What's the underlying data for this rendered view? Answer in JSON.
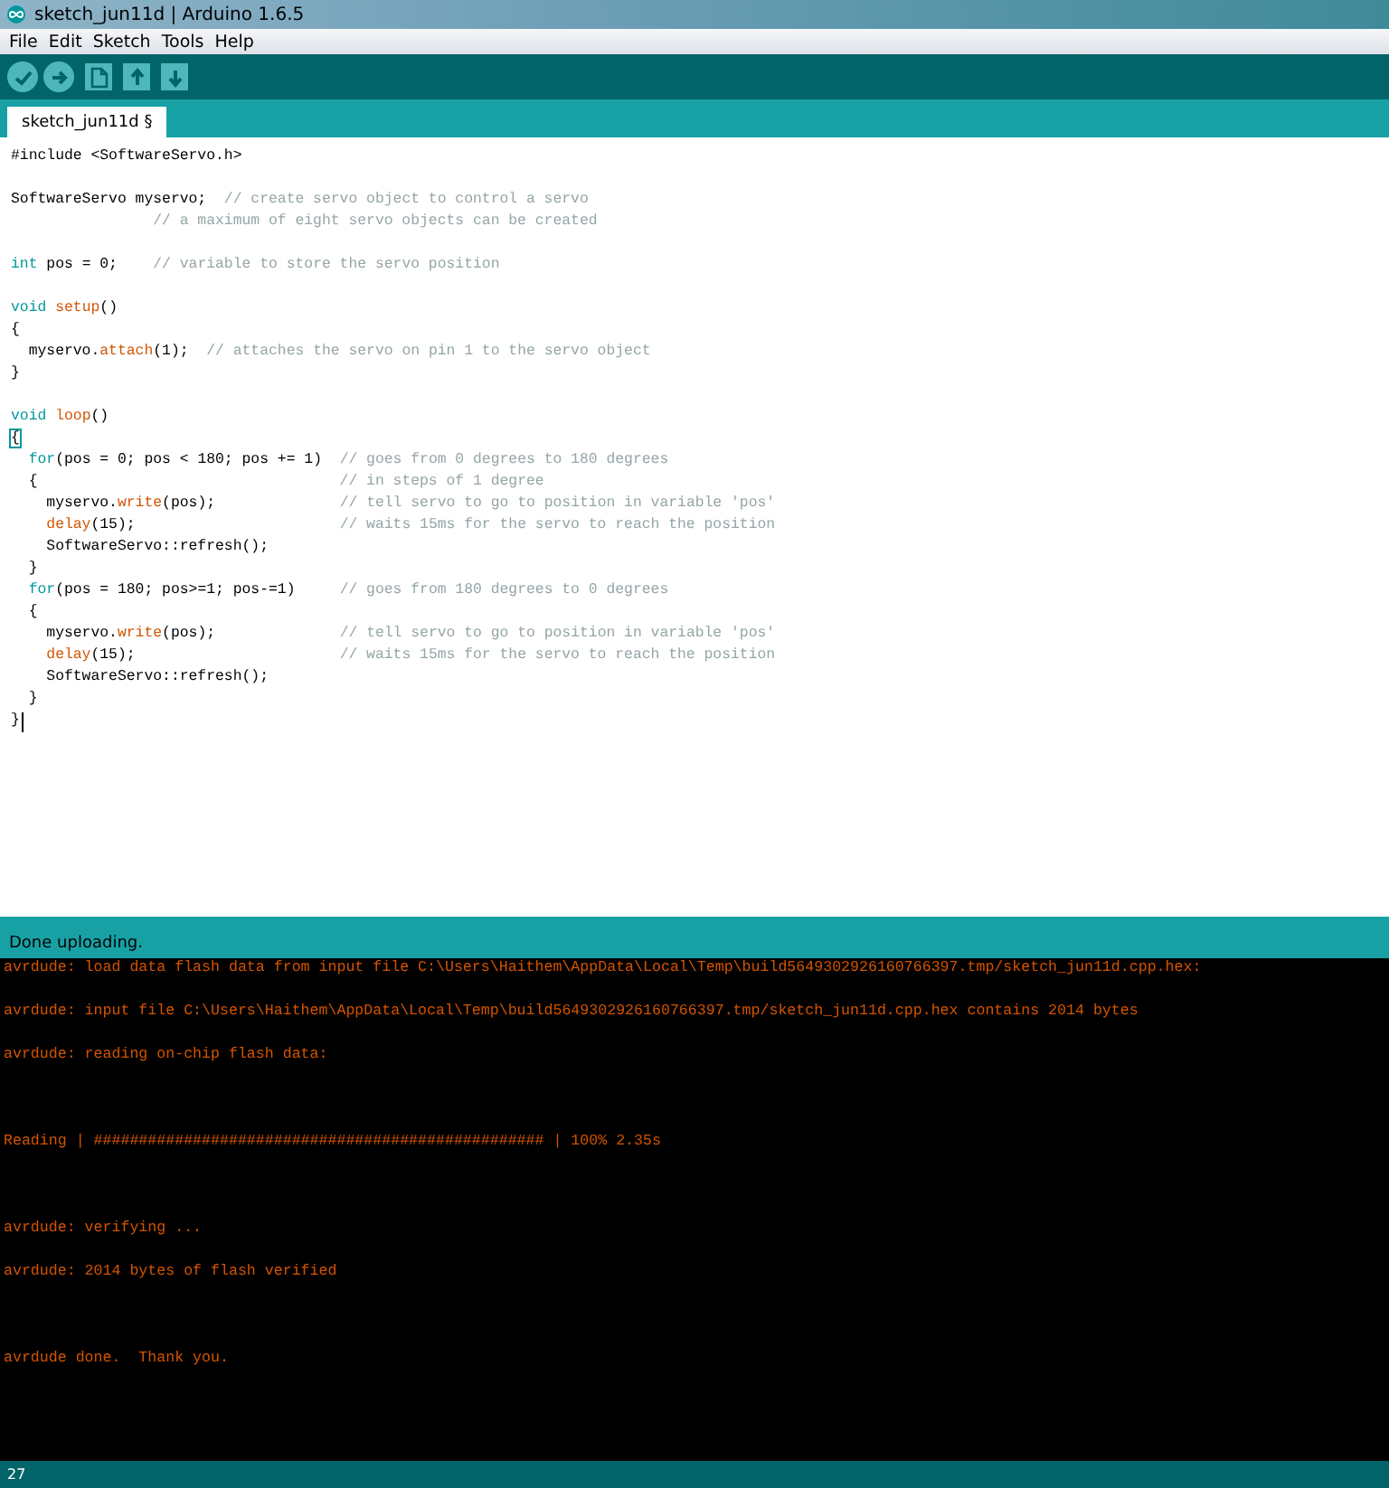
{
  "window": {
    "title": "sketch_jun11d | Arduino 1.6.5"
  },
  "menu": [
    "File",
    "Edit",
    "Sketch",
    "Tools",
    "Help"
  ],
  "toolbar": [
    {
      "kind": "verify"
    },
    {
      "kind": "upload"
    },
    {
      "kind": "new"
    },
    {
      "kind": "open"
    },
    {
      "kind": "save"
    }
  ],
  "tabs": [
    {
      "label": "sketch_jun11d §",
      "selected": true
    }
  ],
  "editor": {
    "lines": [
      {
        "kind": "code",
        "tokens": [
          {
            "t": "#include <SoftwareServo.h>",
            "kind": "plain"
          }
        ]
      },
      {
        "kind": "blank"
      },
      {
        "kind": "code",
        "tokens": [
          {
            "t": "SoftwareServo myservo;  ",
            "kind": "plain"
          },
          {
            "t": "// create servo object to control a servo",
            "kind": "comment"
          }
        ]
      },
      {
        "kind": "code",
        "tokens": [
          {
            "t": "                // a maximum of eight servo objects can be created",
            "kind": "comment"
          }
        ]
      },
      {
        "kind": "blank"
      },
      {
        "kind": "code",
        "tokens": [
          {
            "t": "int",
            "kind": "keyword"
          },
          {
            "t": " pos = 0;    ",
            "kind": "plain"
          },
          {
            "t": "// variable to store the servo position",
            "kind": "comment"
          }
        ]
      },
      {
        "kind": "blank"
      },
      {
        "kind": "code",
        "tokens": [
          {
            "t": "void ",
            "kind": "keyword"
          },
          {
            "t": "setup",
            "kind": "function"
          },
          {
            "t": "()",
            "kind": "plain"
          }
        ]
      },
      {
        "kind": "code",
        "tokens": [
          {
            "t": "{",
            "kind": "plain"
          }
        ]
      },
      {
        "kind": "code",
        "tokens": [
          {
            "t": "  myservo.",
            "kind": "plain"
          },
          {
            "t": "attach",
            "kind": "function"
          },
          {
            "t": "(1);  ",
            "kind": "plain"
          },
          {
            "t": "// attaches the servo on pin 1 to the servo object",
            "kind": "comment"
          }
        ]
      },
      {
        "kind": "code",
        "tokens": [
          {
            "t": "}",
            "kind": "plain"
          }
        ]
      },
      {
        "kind": "blank"
      },
      {
        "kind": "code",
        "tokens": [
          {
            "t": "void ",
            "kind": "keyword"
          },
          {
            "t": "loop",
            "kind": "function"
          },
          {
            "t": "()",
            "kind": "plain"
          }
        ]
      },
      {
        "kind": "code",
        "tokens": [
          {
            "t": "{",
            "kind": "bracket-match"
          }
        ]
      },
      {
        "kind": "code",
        "tokens": [
          {
            "t": "  for",
            "kind": "keyword"
          },
          {
            "t": "(pos = 0; pos < 180; pos += 1)  ",
            "kind": "plain"
          },
          {
            "t": "// goes from 0 degrees to 180 degrees",
            "kind": "comment"
          }
        ]
      },
      {
        "kind": "code",
        "tokens": [
          {
            "t": "  {                                  ",
            "kind": "plain"
          },
          {
            "t": "// in steps of 1 degree",
            "kind": "comment"
          }
        ]
      },
      {
        "kind": "code",
        "tokens": [
          {
            "t": "    myservo.",
            "kind": "plain"
          },
          {
            "t": "write",
            "kind": "function"
          },
          {
            "t": "(pos);              ",
            "kind": "plain"
          },
          {
            "t": "// tell servo to go to position in variable 'pos'",
            "kind": "comment"
          }
        ]
      },
      {
        "kind": "code",
        "tokens": [
          {
            "t": "    delay",
            "kind": "function"
          },
          {
            "t": "(15);                       ",
            "kind": "plain"
          },
          {
            "t": "// waits 15ms for the servo to reach the position",
            "kind": "comment"
          }
        ]
      },
      {
        "kind": "code",
        "tokens": [
          {
            "t": "    SoftwareServo::refresh();",
            "kind": "plain"
          }
        ]
      },
      {
        "kind": "code",
        "tokens": [
          {
            "t": "  }",
            "kind": "plain"
          }
        ]
      },
      {
        "kind": "code",
        "tokens": [
          {
            "t": "  for",
            "kind": "keyword"
          },
          {
            "t": "(pos = 180; pos>=1; pos-=1)     ",
            "kind": "plain"
          },
          {
            "t": "// goes from 180 degrees to 0 degrees",
            "kind": "comment"
          }
        ]
      },
      {
        "kind": "code",
        "tokens": [
          {
            "t": "  {",
            "kind": "plain"
          }
        ]
      },
      {
        "kind": "code",
        "tokens": [
          {
            "t": "    myservo.",
            "kind": "plain"
          },
          {
            "t": "write",
            "kind": "function"
          },
          {
            "t": "(pos);              ",
            "kind": "plain"
          },
          {
            "t": "// tell servo to go to position in variable 'pos'",
            "kind": "comment"
          }
        ]
      },
      {
        "kind": "code",
        "tokens": [
          {
            "t": "    delay",
            "kind": "function"
          },
          {
            "t": "(15);                       ",
            "kind": "plain"
          },
          {
            "t": "// waits 15ms for the servo to reach the position",
            "kind": "comment"
          }
        ]
      },
      {
        "kind": "code",
        "tokens": [
          {
            "t": "    SoftwareServo::refresh();",
            "kind": "plain"
          }
        ]
      },
      {
        "kind": "code",
        "tokens": [
          {
            "t": "  }",
            "kind": "plain"
          }
        ]
      },
      {
        "kind": "code",
        "cursor": true,
        "tokens": [
          {
            "t": "}",
            "kind": "plain"
          }
        ]
      }
    ]
  },
  "status": {
    "message": "Done uploading."
  },
  "console": {
    "lines": [
      {
        "kind": "text",
        "text": "avrdude: load data flash data from input file C:\\Users\\Haithem\\AppData\\Local\\Temp\\build5649302926160766397.tmp/sketch_jun11d.cpp.hex:"
      },
      {
        "kind": "blank"
      },
      {
        "kind": "text",
        "text": "avrdude: input file C:\\Users\\Haithem\\AppData\\Local\\Temp\\build5649302926160766397.tmp/sketch_jun11d.cpp.hex contains 2014 bytes"
      },
      {
        "kind": "blank"
      },
      {
        "kind": "text",
        "text": "avrdude: reading on-chip flash data:"
      },
      {
        "kind": "blank"
      },
      {
        "kind": "blank"
      },
      {
        "kind": "blank"
      },
      {
        "kind": "text",
        "text": "Reading | ################################################## | 100% 2.35s"
      },
      {
        "kind": "blank"
      },
      {
        "kind": "blank"
      },
      {
        "kind": "blank"
      },
      {
        "kind": "text",
        "text": "avrdude: verifying ..."
      },
      {
        "kind": "blank"
      },
      {
        "kind": "text",
        "text": "avrdude: 2014 bytes of flash verified"
      },
      {
        "kind": "blank"
      },
      {
        "kind": "blank"
      },
      {
        "kind": "blank"
      },
      {
        "kind": "text",
        "text": "avrdude done.  Thank you."
      }
    ]
  },
  "footer": {
    "line_number": "27"
  }
}
